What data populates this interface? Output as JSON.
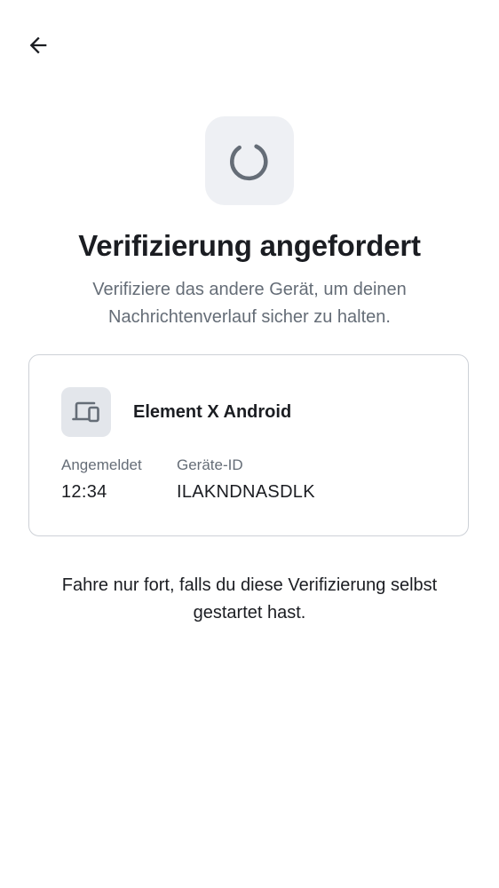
{
  "header": {
    "back_icon": "arrow-left-icon"
  },
  "hero": {
    "icon": "spinner-icon",
    "title": "Verifizierung angefordert",
    "subtitle": "Verifiziere das andere Gerät, um deinen Nachrichtenverlauf sicher zu halten."
  },
  "device": {
    "icon": "devices-icon",
    "name": "Element X Android",
    "signed_in_label": "Angemeldet",
    "signed_in_value": "12:34",
    "device_id_label": "Geräte-ID",
    "device_id_value": "ILAKNDNASDLK"
  },
  "warning": "Fahre nur fort, falls du diese Verifizierung selbst gestartet hast.",
  "colors": {
    "text_primary": "#1b1d22",
    "text_secondary": "#656d77",
    "icon_tile_bg": "#eef0f4",
    "card_border": "#cdd1d7"
  }
}
